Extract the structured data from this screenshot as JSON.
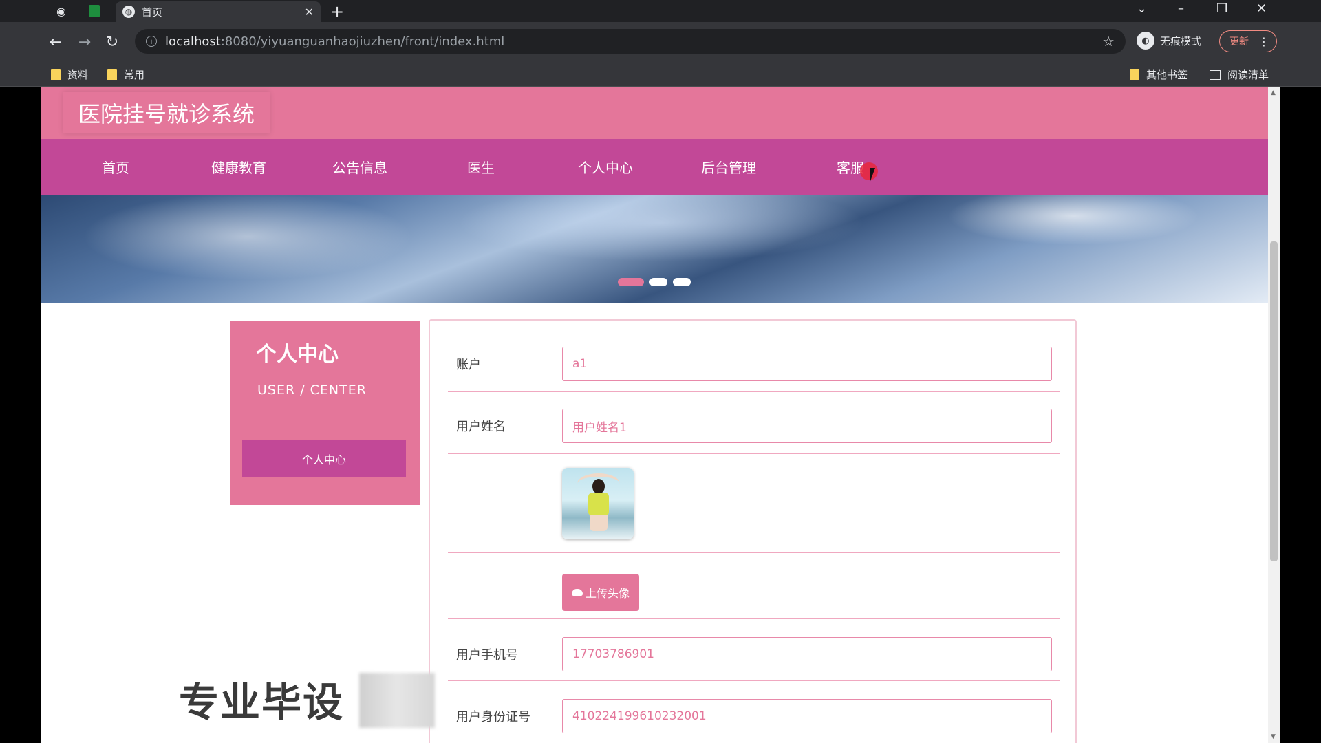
{
  "browser": {
    "tab_title": "首页",
    "tab_close": "✕",
    "new_tab": "+",
    "url_host": "localhost",
    "url_path": ":8080/yiyuanguanhaojiuzhen/front/index.html",
    "incognito_label": "无痕模式",
    "update_label": "更新",
    "bookmarks": [
      {
        "label": "资料"
      },
      {
        "label": "常用"
      }
    ],
    "other_bookmarks": "其他书签",
    "reading_list": "阅读清单"
  },
  "site": {
    "title": "医院挂号就诊系统",
    "nav": [
      "首页",
      "健康教育",
      "公告信息",
      "医生",
      "个人中心",
      "后台管理",
      "客服"
    ]
  },
  "sidebar": {
    "heading": "个人中心",
    "subheading": "USER / CENTER",
    "button": "个人中心"
  },
  "form": {
    "account_label": "账户",
    "account_value": "a1",
    "name_label": "用户姓名",
    "name_value": "用户姓名1",
    "upload_label": "上传头像",
    "phone_label": "用户手机号",
    "phone_value": "17703786901",
    "idcard_label": "用户身份证号",
    "idcard_value": "410224199610232001"
  },
  "overlay": {
    "watermark": "专业毕设"
  },
  "colors": {
    "header_pink": "#e4769a",
    "nav_magenta": "#c24897",
    "field_border": "#e889a9"
  }
}
